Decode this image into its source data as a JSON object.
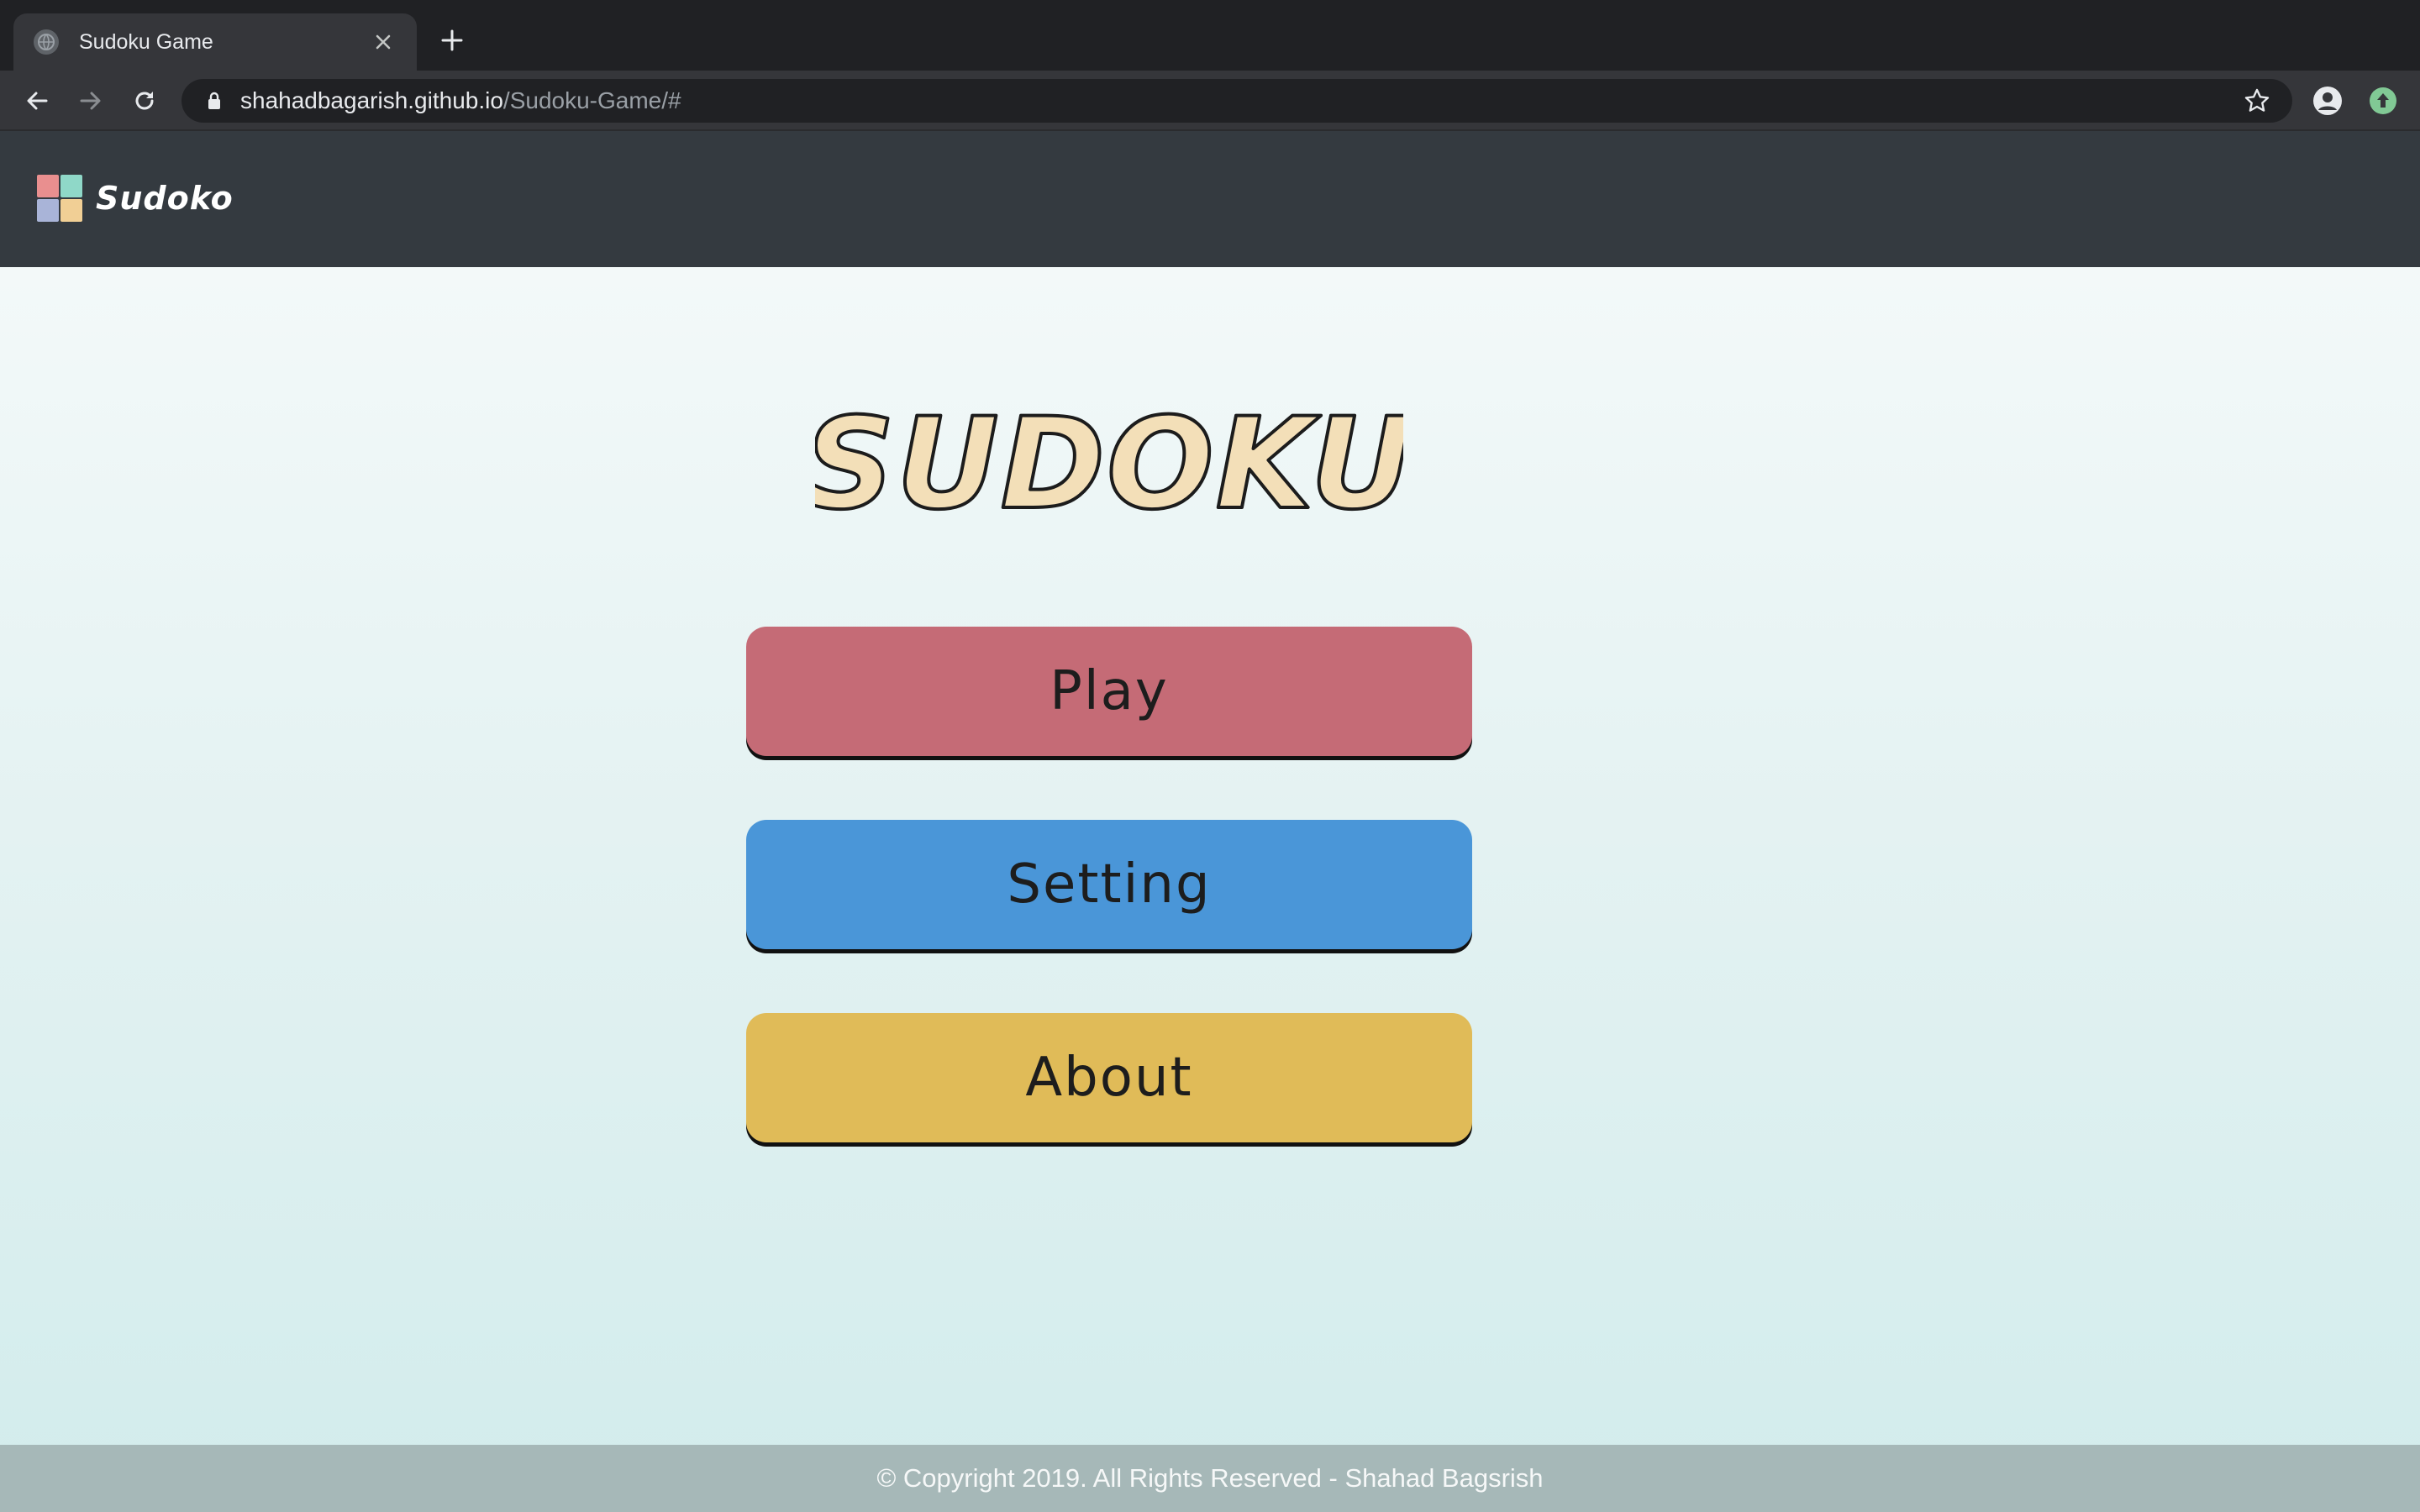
{
  "browser": {
    "tab": {
      "title": "Sudoku Game"
    },
    "address": {
      "host": "shahadbagarish.github.io",
      "path": "/Sudoku-Game/#"
    },
    "icons": {
      "favicon": "globe-icon",
      "close": "close-icon",
      "new_tab": "plus-icon",
      "back": "back-arrow-icon",
      "forward": "forward-arrow-icon",
      "reload": "reload-icon",
      "lock": "lock-icon",
      "bookmark": "star-icon",
      "profile": "account-icon",
      "update": "update-icon"
    }
  },
  "navbar": {
    "brand": "Sudoko"
  },
  "main": {
    "title": "SUDOKU",
    "buttons": {
      "play": "Play",
      "setting": "Setting",
      "about": "About"
    }
  },
  "footer": {
    "text": "© Copyright 2019. All Rights Reserved - Shahad Bagsrish"
  },
  "colors": {
    "navbar": "#343a40",
    "play": "#c56b76",
    "setting": "#4a96d8",
    "about": "#e0bb58",
    "title_fill": "#f3dfb8",
    "footer": "#a6b8b8"
  }
}
